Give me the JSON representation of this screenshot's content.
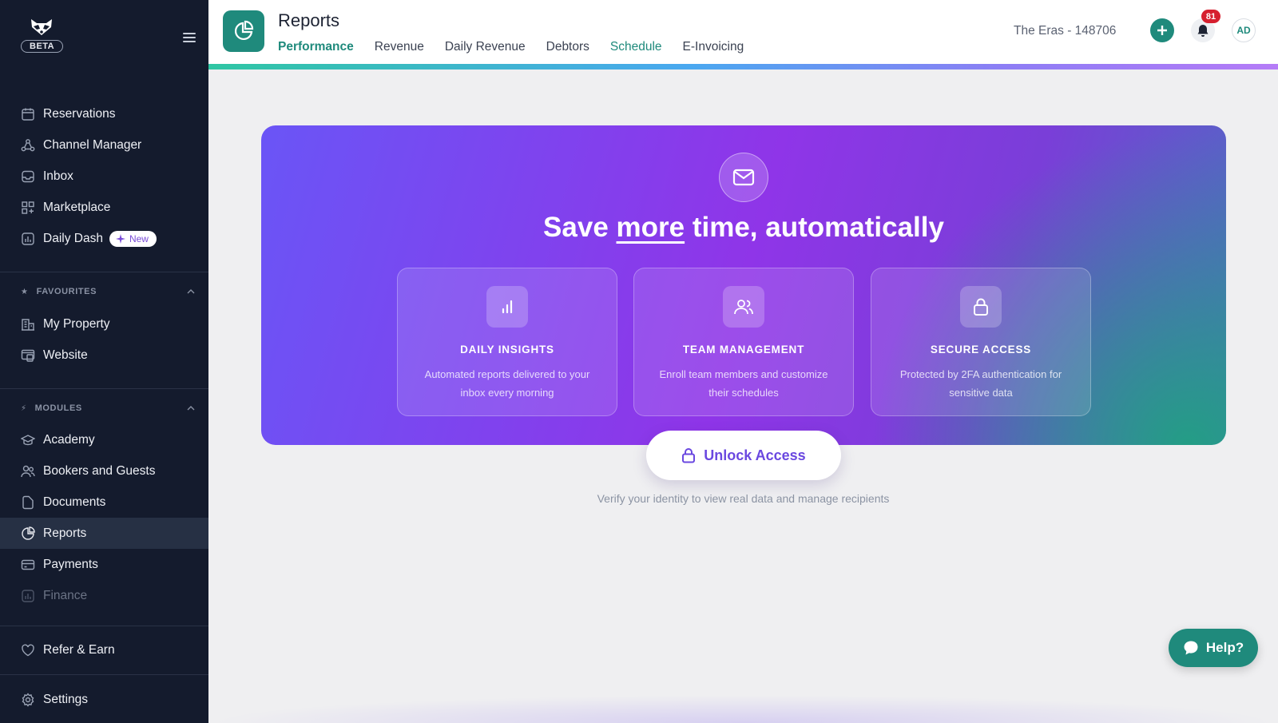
{
  "sidebar": {
    "badge": "BETA",
    "nav_items": [
      {
        "label": "Reservations",
        "icon": "calendar-icon"
      },
      {
        "label": "Channel Manager",
        "icon": "network-icon"
      },
      {
        "label": "Inbox",
        "icon": "inbox-icon"
      },
      {
        "label": "Marketplace",
        "icon": "grid-icon"
      },
      {
        "label": "Daily Dash",
        "icon": "chart-icon",
        "badge": "New"
      }
    ],
    "favourites_label": "FAVOURITES",
    "favourites": [
      {
        "label": "My Property",
        "icon": "building-icon"
      },
      {
        "label": "Website",
        "icon": "website-icon"
      }
    ],
    "modules_label": "MODULES",
    "modules": [
      {
        "label": "Academy",
        "icon": "graduation-icon"
      },
      {
        "label": "Bookers and Guests",
        "icon": "users-icon"
      },
      {
        "label": "Documents",
        "icon": "document-icon"
      },
      {
        "label": "Reports",
        "icon": "pie-icon"
      },
      {
        "label": "Payments",
        "icon": "card-icon"
      },
      {
        "label": "Finance",
        "icon": "finance-icon"
      }
    ],
    "refer": "Refer & Earn",
    "settings": "Settings"
  },
  "header": {
    "title": "Reports",
    "tabs": [
      "Performance",
      "Revenue",
      "Daily Revenue",
      "Debtors",
      "Schedule",
      "E-Invoicing"
    ],
    "active_tab": "Performance",
    "property": "The Eras - 148706",
    "notifications": "81",
    "avatar": "AD"
  },
  "hero": {
    "headline_pre": "Save ",
    "headline_em": "more",
    "headline_post": " time, automatically",
    "features": [
      {
        "title": "DAILY INSIGHTS",
        "desc": "Automated reports delivered to your inbox every morning",
        "icon": "bar-chart-icon"
      },
      {
        "title": "TEAM MANAGEMENT",
        "desc": "Enroll team members and customize their schedules",
        "icon": "team-icon"
      },
      {
        "title": "SECURE ACCESS",
        "desc": "Protected by 2FA authentication for sensitive data",
        "icon": "lock-icon"
      }
    ]
  },
  "unlock_label": "Unlock Access",
  "verify_text": "Verify your identity to view real data and manage recipients",
  "help_label": "Help?",
  "colors": {
    "accent": "#1f8a7c",
    "sidebar": "#141b2d",
    "purple": "#8f35e8"
  }
}
